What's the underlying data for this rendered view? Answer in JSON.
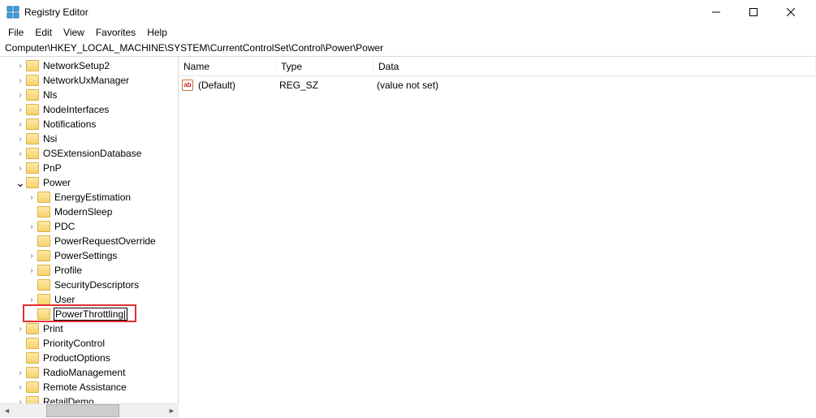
{
  "window": {
    "title": "Registry Editor"
  },
  "menu": {
    "file": "File",
    "edit": "Edit",
    "view": "View",
    "favorites": "Favorites",
    "help": "Help"
  },
  "address": "Computer\\HKEY_LOCAL_MACHINE\\SYSTEM\\CurrentControlSet\\Control\\Power\\Power",
  "tree": [
    {
      "label": "NetworkSetup2",
      "indent": 1,
      "chevron": ">"
    },
    {
      "label": "NetworkUxManager",
      "indent": 1,
      "chevron": ">"
    },
    {
      "label": "Nls",
      "indent": 1,
      "chevron": ">"
    },
    {
      "label": "NodeInterfaces",
      "indent": 1,
      "chevron": ">"
    },
    {
      "label": "Notifications",
      "indent": 1,
      "chevron": ">"
    },
    {
      "label": "Nsi",
      "indent": 1,
      "chevron": ">"
    },
    {
      "label": "OSExtensionDatabase",
      "indent": 1,
      "chevron": ">"
    },
    {
      "label": "PnP",
      "indent": 1,
      "chevron": ">"
    },
    {
      "label": "Power",
      "indent": 1,
      "chevron": "v",
      "expanded": true
    },
    {
      "label": "EnergyEstimation",
      "indent": 2,
      "chevron": ">"
    },
    {
      "label": "ModernSleep",
      "indent": 2,
      "chevron": ""
    },
    {
      "label": "PDC",
      "indent": 2,
      "chevron": ">"
    },
    {
      "label": "PowerRequestOverride",
      "indent": 2,
      "chevron": ""
    },
    {
      "label": "PowerSettings",
      "indent": 2,
      "chevron": ">"
    },
    {
      "label": "Profile",
      "indent": 2,
      "chevron": ">"
    },
    {
      "label": "SecurityDescriptors",
      "indent": 2,
      "chevron": ""
    },
    {
      "label": "User",
      "indent": 2,
      "chevron": ">"
    },
    {
      "label": "PowerThrottling",
      "indent": 2,
      "chevron": "",
      "editing": true,
      "highlighted": true
    },
    {
      "label": "Print",
      "indent": 1,
      "chevron": ">"
    },
    {
      "label": "PriorityControl",
      "indent": 1,
      "chevron": ""
    },
    {
      "label": "ProductOptions",
      "indent": 1,
      "chevron": ""
    },
    {
      "label": "RadioManagement",
      "indent": 1,
      "chevron": ">"
    },
    {
      "label": "Remote Assistance",
      "indent": 1,
      "chevron": ">"
    },
    {
      "label": "RetailDemo",
      "indent": 1,
      "chevron": ">"
    }
  ],
  "list": {
    "columns": {
      "name": "Name",
      "type": "Type",
      "data": "Data"
    },
    "rows": [
      {
        "name": "(Default)",
        "type": "REG_SZ",
        "data": "(value not set)"
      }
    ]
  },
  "value_icon_text": "ab"
}
